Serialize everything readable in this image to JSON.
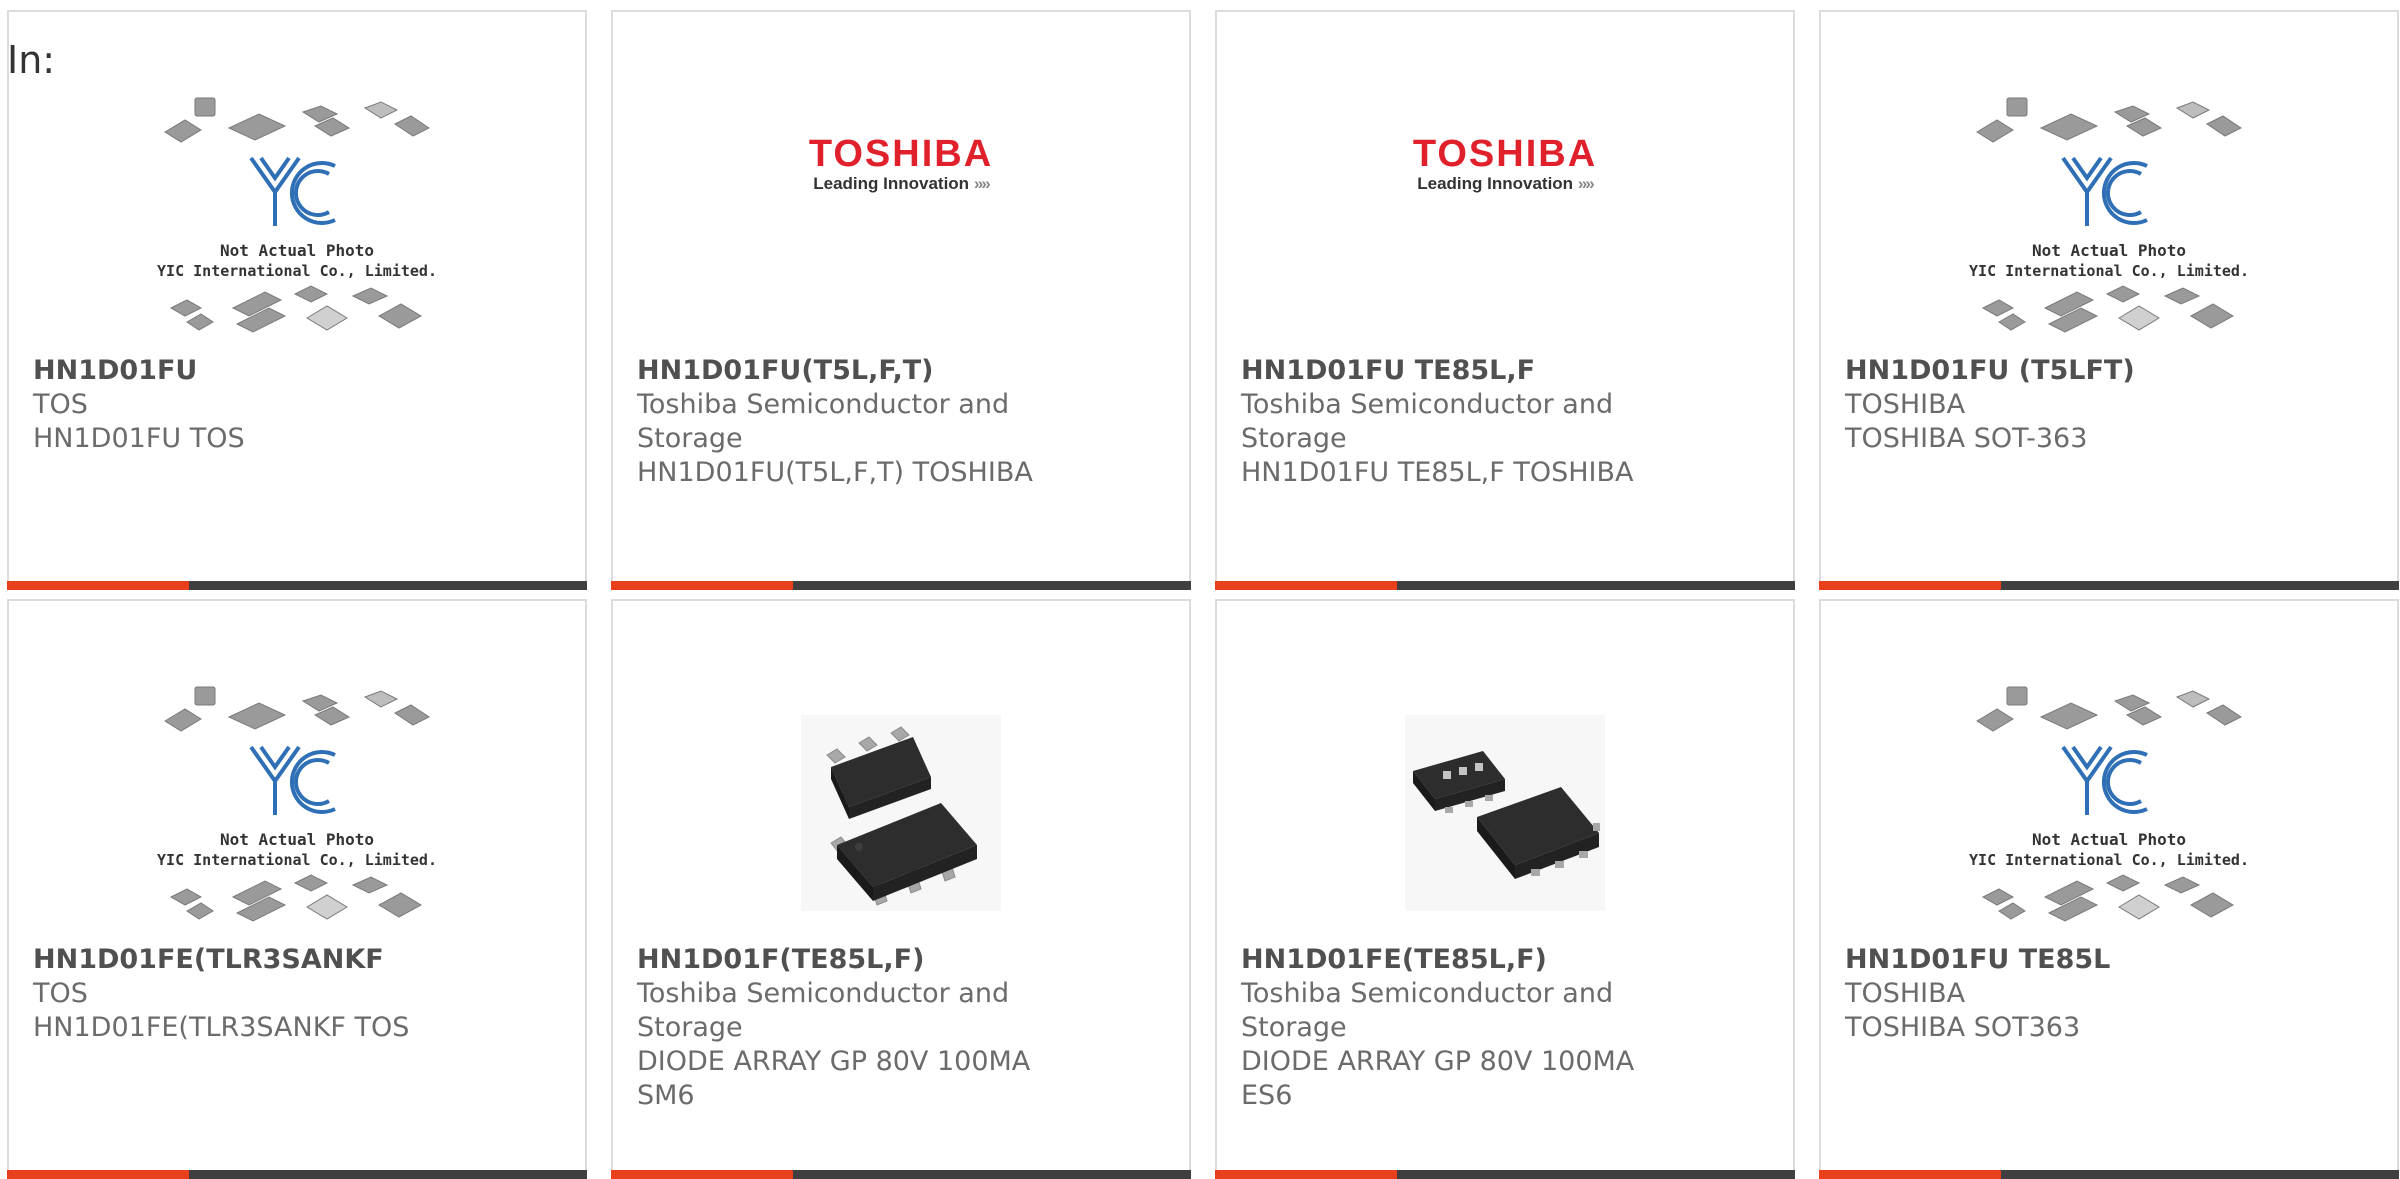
{
  "page": {
    "in_label": "In:"
  },
  "colors": {
    "accent_bar": "#e8401c",
    "dark_bar": "#3f3f3f",
    "toshiba_red": "#e0202b",
    "yic_blue": "#2f6fb5"
  },
  "placeholder": {
    "line1": "Not Actual Photo",
    "line2": "YIC International Co., Limited.",
    "logo_text": "YIC"
  },
  "logo": {
    "brand": "TOSHIBA",
    "tagline": "Leading Innovation",
    "arrows": "»»"
  },
  "products": [
    {
      "part": "HN1D01FU",
      "image": "yic-placeholder-image",
      "manufacturer": "TOS",
      "description": "HN1D01FU TOS"
    },
    {
      "part": "HN1D01FU(T5L,F,T)",
      "image": "toshiba-logo",
      "manufacturer": "Toshiba Semiconductor and\nStorage",
      "description": "HN1D01FU(T5L,F,T) TOSHIBA"
    },
    {
      "part": "HN1D01FU TE85L,F",
      "image": "toshiba-logo",
      "manufacturer": "Toshiba Semiconductor and\nStorage",
      "description": "HN1D01FU TE85L,F TOSHIBA"
    },
    {
      "part": "HN1D01FU (T5LFT)",
      "image": "yic-placeholder-image",
      "manufacturer": "TOSHIBA",
      "description": "TOSHIBA SOT-363"
    },
    {
      "part": "HN1D01FE(TLR3SANKF",
      "image": "yic-placeholder-image",
      "manufacturer": "TOS",
      "description": "HN1D01FE(TLR3SANKF TOS"
    },
    {
      "part": "HN1D01F(TE85L,F)",
      "image": "sm6-package-photo",
      "manufacturer": "Toshiba Semiconductor and\nStorage",
      "description": "DIODE ARRAY GP 80V 100MA\nSM6"
    },
    {
      "part": "HN1D01FE(TE85L,F)",
      "image": "es6-package-photo",
      "manufacturer": "Toshiba Semiconductor and\nStorage",
      "description": "DIODE ARRAY GP 80V 100MA\nES6"
    },
    {
      "part": "HN1D01FU TE85L",
      "image": "yic-placeholder-image",
      "manufacturer": "TOSHIBA",
      "description": "TOSHIBA SOT363"
    }
  ]
}
